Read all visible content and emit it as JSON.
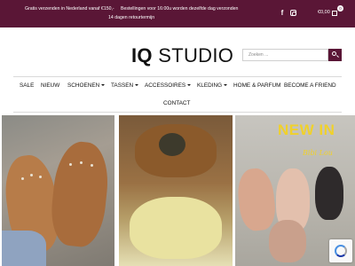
{
  "topbar": {
    "messages": [
      "Gratis verzenden in Nederland vanaf €150,-",
      "Bestellingen voor 16:00u worden dezelfde dag verzonden",
      "14 dagen retourtermijn"
    ],
    "social": [
      "facebook-icon",
      "instagram-icon"
    ],
    "cart_total": "€0,00",
    "cart_count": "0",
    "background": "#5a1636"
  },
  "logo": {
    "bold": "IQ",
    "light": "STUDIO"
  },
  "search": {
    "placeholder": "Zoeken ...",
    "button_color": "#5a1636"
  },
  "nav": [
    {
      "label": "SALE"
    },
    {
      "label": "NIEUW"
    },
    {
      "label": "SCHOENEN",
      "dropdown": true
    },
    {
      "label": "TASSEN",
      "dropdown": true
    },
    {
      "label": "ACCESSOIRES",
      "dropdown": true
    },
    {
      "label": "KLEDING",
      "dropdown": true
    },
    {
      "label": "HOME & PARFUM"
    },
    {
      "label": "BECOME A FRIEND"
    },
    {
      "label": "CONTACT"
    }
  ],
  "promo": {
    "title": "NEW IN",
    "subtitle": "Bibi Lou"
  }
}
